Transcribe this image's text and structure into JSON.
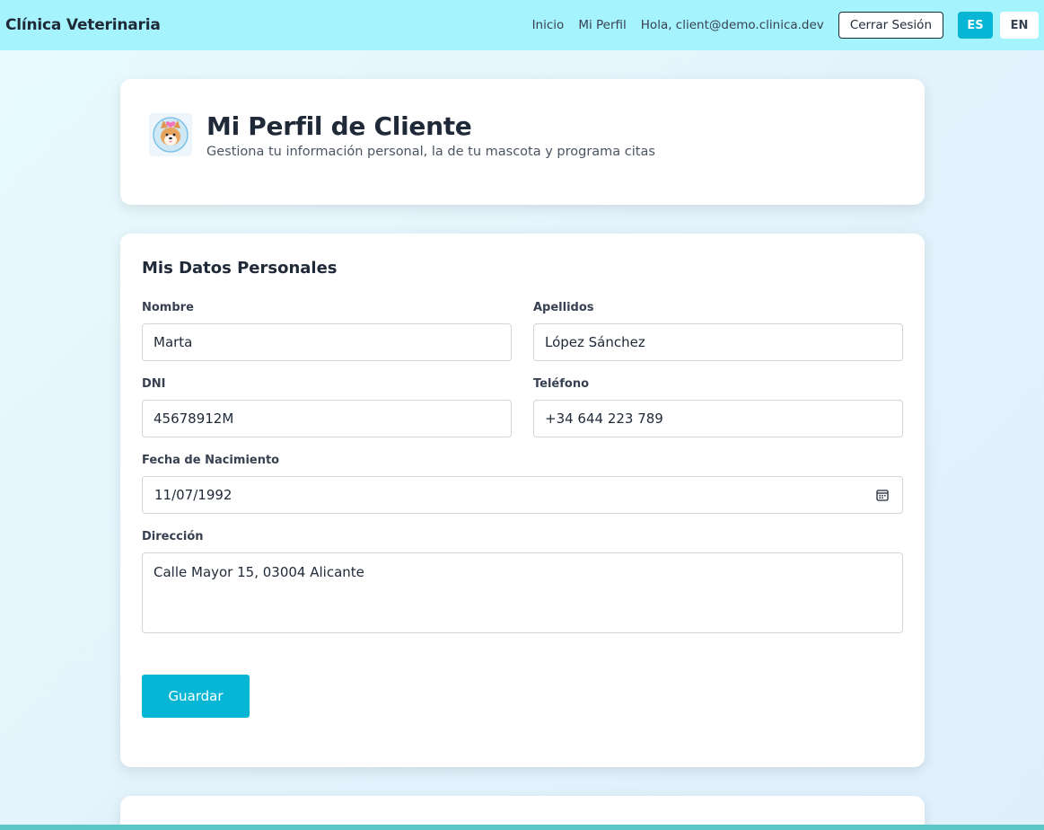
{
  "navbar": {
    "brand": "Clínica Veterinaria",
    "links": [
      "Inicio",
      "Mi Perfil"
    ],
    "greeting": "Hola, client@demo.clinica.dev",
    "logout_label": "Cerrar Sesión",
    "lang_active": "ES",
    "lang_inactive": "EN"
  },
  "header": {
    "avatar_icon": "dog-heart-icon",
    "title": "Mi Perfil de Cliente",
    "subtitle": "Gestiona tu información personal, la de tu mascota y programa citas"
  },
  "form": {
    "section_title": "Mis Datos Personales",
    "fields": {
      "nombre": {
        "label": "Nombre",
        "value": "Marta"
      },
      "apellidos": {
        "label": "Apellidos",
        "value": "López Sánchez"
      },
      "dni": {
        "label": "DNI",
        "value": "45678912M"
      },
      "telefono": {
        "label": "Teléfono",
        "value": "+34 644 223 789"
      },
      "fecha": {
        "label": "Fecha de Nacimiento",
        "value": "11/07/1992"
      },
      "direccion": {
        "label": "Dirección",
        "value": "Calle Mayor 15, 03004 Alicante"
      }
    },
    "save_label": "Guardar"
  },
  "colors": {
    "navbar_bg": "#a5f3fc",
    "accent": "#06b6d4",
    "text_dark": "#1f2937"
  }
}
